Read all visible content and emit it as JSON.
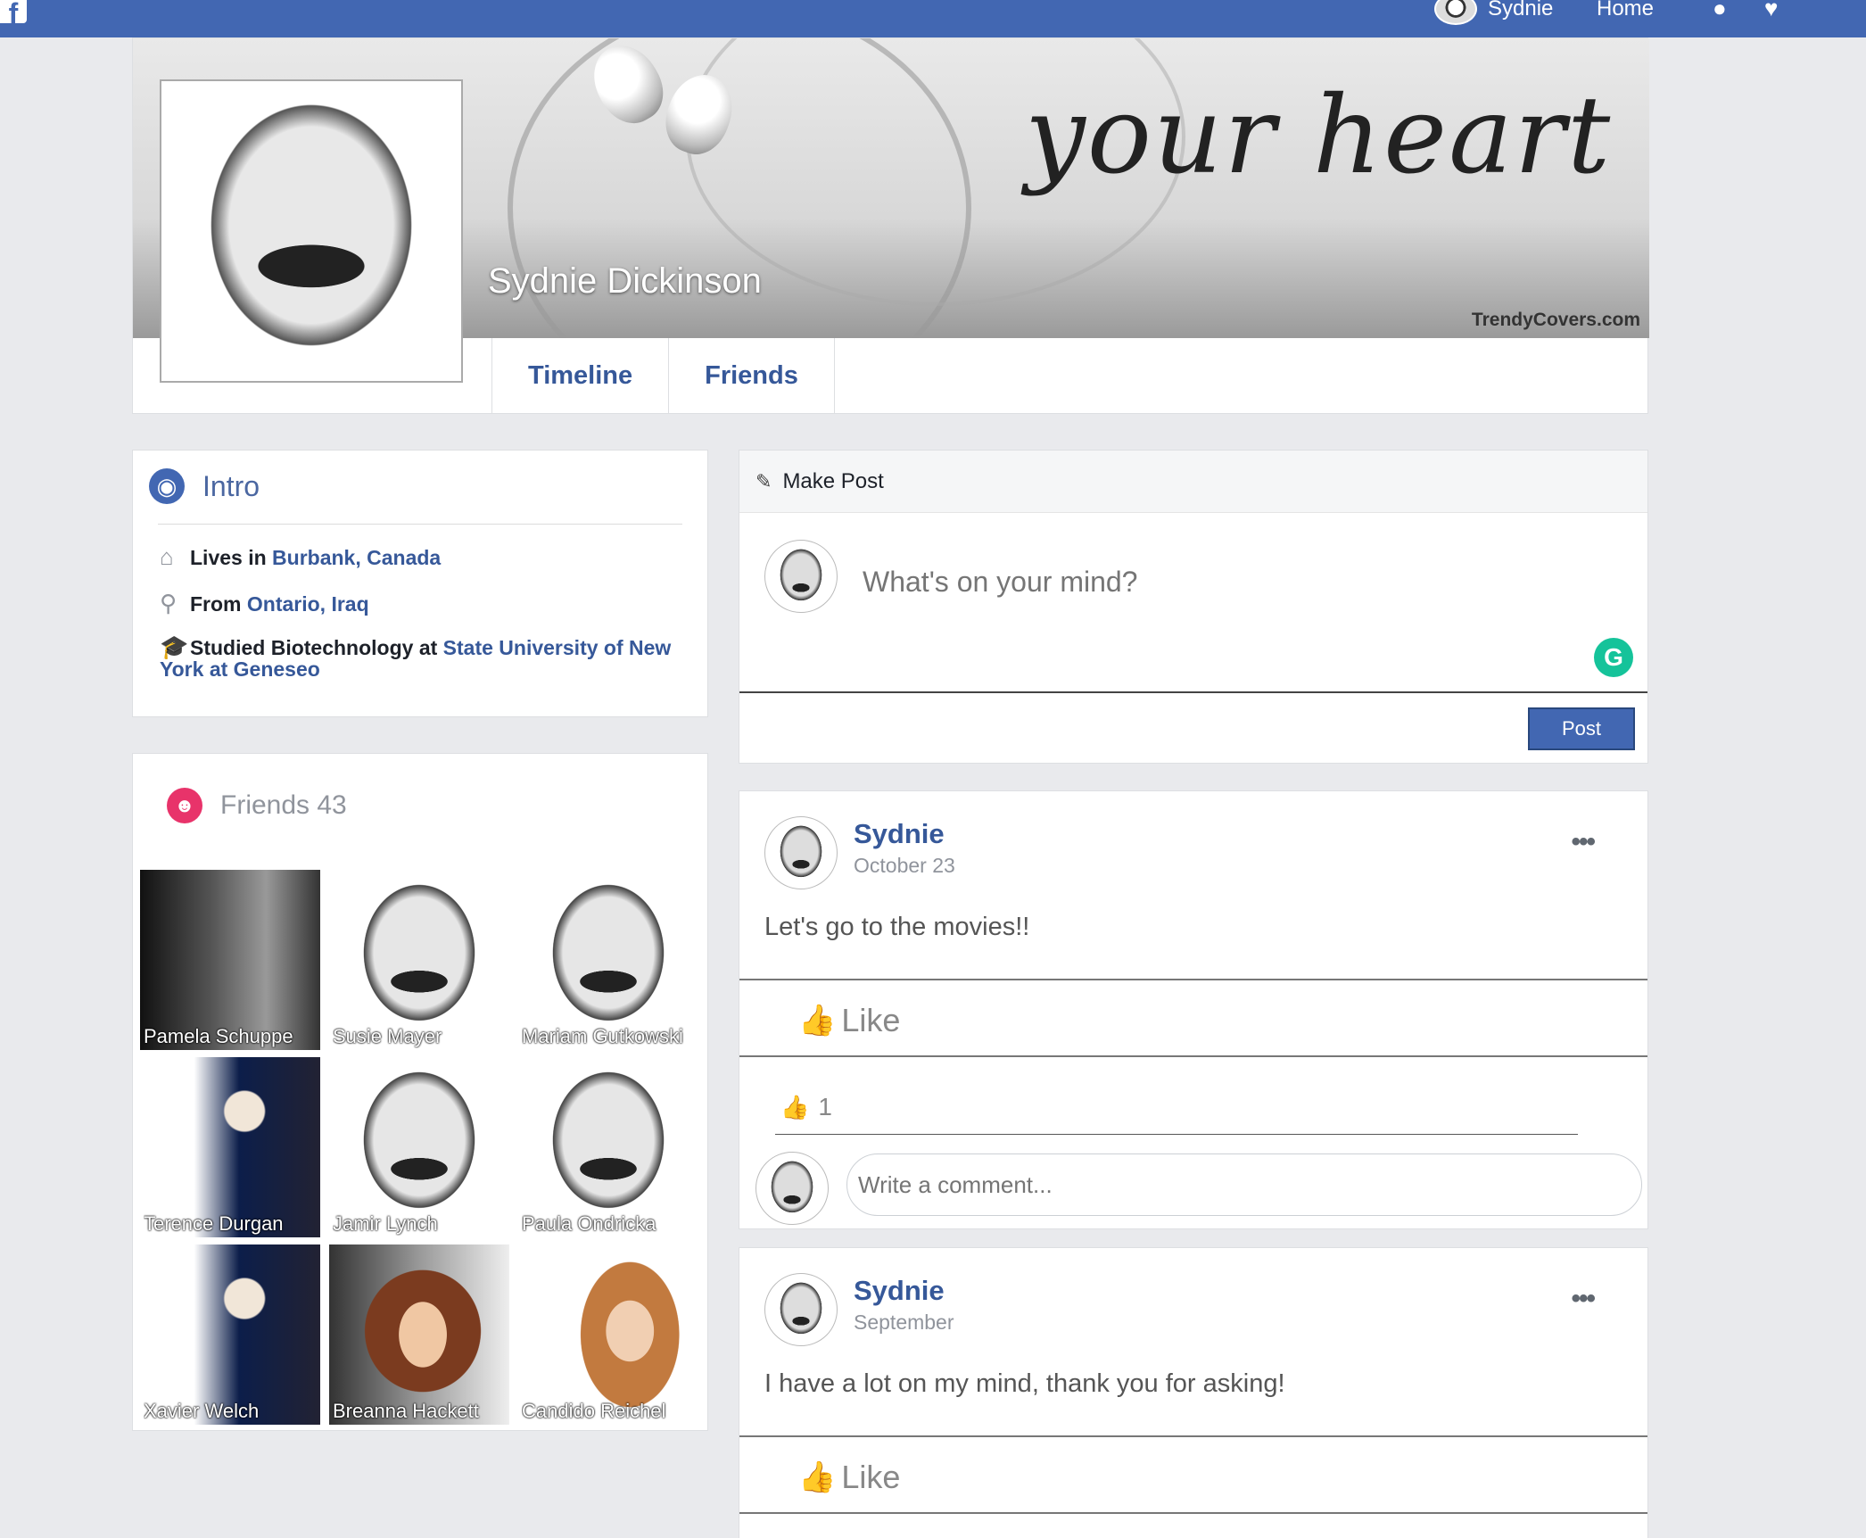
{
  "topbar": {
    "logo": "f",
    "user_name": "Sydnie",
    "home_label": "Home",
    "icons": [
      "friends-icon",
      "notifications-icon"
    ]
  },
  "cover": {
    "script_text": "your heart",
    "watermark": "TrendyCovers.com",
    "profile_name": "Sydnie Dickinson",
    "tabs": [
      "Timeline",
      "Friends"
    ]
  },
  "intro": {
    "title": "Intro",
    "lives_prefix": "Lives in ",
    "lives_link": "Burbank, Canada",
    "from_prefix": "From ",
    "from_link": "Ontario, Iraq",
    "studied_prefix": "Studied Biotechnology at ",
    "studied_link": "State University of New York at Geneseo"
  },
  "friends": {
    "title": "Friends 43",
    "list": [
      {
        "name": "Pamela Schuppe",
        "pic": "dark"
      },
      {
        "name": "Susie Mayer",
        "pic": "joker"
      },
      {
        "name": "Mariam Gutkowski",
        "pic": "joker"
      },
      {
        "name": "Terence Durgan",
        "pic": "puppet"
      },
      {
        "name": "Jamir Lynch",
        "pic": "joker"
      },
      {
        "name": "Paula Ondricka",
        "pic": "joker"
      },
      {
        "name": "Xavier Welch",
        "pic": "puppet"
      },
      {
        "name": "Breanna Hackett",
        "pic": "leia"
      },
      {
        "name": "Candido Reichel",
        "pic": "rowling"
      }
    ]
  },
  "make_post": {
    "title": "Make Post",
    "placeholder": "What's on your mind?",
    "post_button": "Post"
  },
  "posts": [
    {
      "author": "Sydnie",
      "date": "October 23",
      "text": "Let's go to the movies!!",
      "like_label": "Like",
      "like_count": "1",
      "comment_placeholder": "Write a comment...",
      "liked": true
    },
    {
      "author": "Sydnie",
      "date": "September",
      "text": "I have a lot on my mind, thank you for asking!",
      "like_label": "Like",
      "liked": false
    }
  ],
  "colors": {
    "brand": "#4267b2",
    "link": "#365899",
    "background": "#e9eaed",
    "grammarly": "#15c39a",
    "friends_icon": "#e8336a"
  }
}
